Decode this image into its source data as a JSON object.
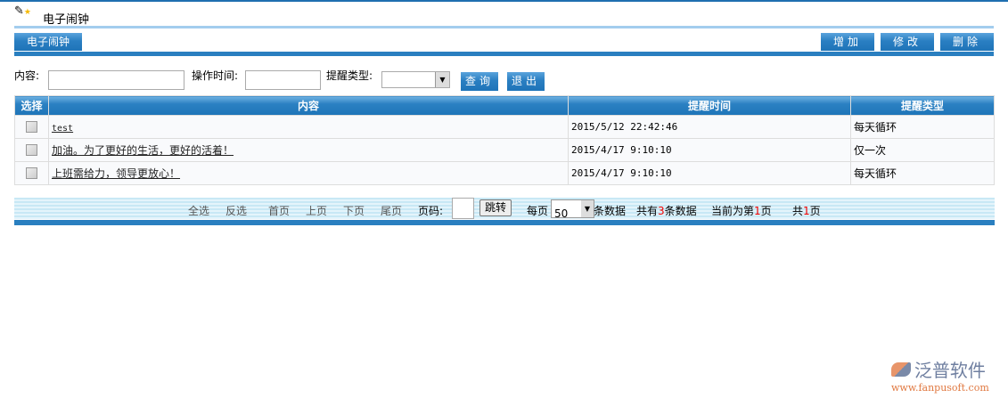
{
  "header": {
    "title": "电子闹钟",
    "icon": "pen-star-icon"
  },
  "tab": {
    "label": "电子闹钟"
  },
  "toolbar": {
    "add": "增加",
    "edit": "修改",
    "delete": "删除"
  },
  "search": {
    "content_label": "内容:",
    "content_value": "",
    "time_label": "操作时间:",
    "time_value": "",
    "type_label": "提醒类型:",
    "type_value": "",
    "query": "查询",
    "exit": "退出"
  },
  "table": {
    "headers": [
      "选择",
      "内容",
      "提醒时间",
      "提醒类型"
    ],
    "rows": [
      {
        "content": "test",
        "time": "2015/5/12 22:42:46",
        "type": "每天循环"
      },
      {
        "content": "加油。为了更好的生活，更好的活着！",
        "time": "2015/4/17 9:10:10",
        "type": "仅一次"
      },
      {
        "content": "上班需给力，领导更放心！",
        "time": "2015/4/17 9:10:10",
        "type": "每天循环"
      }
    ]
  },
  "pager": {
    "select_all": "全选",
    "invert": "反选",
    "first": "首页",
    "prev": "上页",
    "next": "下页",
    "last": "尾页",
    "page_label": "页码:",
    "jump": "跳转",
    "per_page_label": "每页",
    "per_page": "50",
    "records_unit": "条数据",
    "total_prefix": "共有",
    "total": "3",
    "total_suffix": "条数据",
    "current_prefix": "当前为第",
    "current": "1",
    "current_suffix": "页",
    "pages_prefix": "共",
    "pages": "1",
    "pages_suffix": "页"
  },
  "logo": {
    "name": "泛普软件",
    "url": "www.fanpusoft.com"
  }
}
